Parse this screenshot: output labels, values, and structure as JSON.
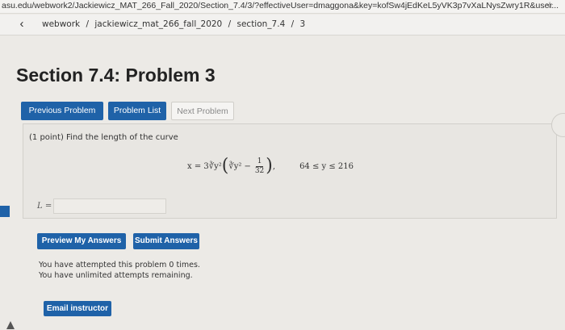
{
  "browser": {
    "url": "asu.edu/webwork2/Jackiewicz_MAT_266_Fall_2020/Section_7.4/3/?effectiveUser=dmaggona&key=kofSw4jEdKeL5yVK3p7vXaLNysZwry1R&user..."
  },
  "breadcrumb": {
    "items": [
      "webwork",
      "jackiewicz_mat_266_fall_2020",
      "section_7.4",
      "3"
    ],
    "separator": "/"
  },
  "page": {
    "title": "Section 7.4: Problem 3"
  },
  "nav": {
    "previous_label": "Previous Problem",
    "list_label": "Problem List",
    "next_label": "Next Problem"
  },
  "problem": {
    "points_text": "(1 point) Find the length of the curve",
    "formula_lhs": "x = 3",
    "formula_root": "∛",
    "formula_term": "y²",
    "formula_open": "(",
    "formula_inner_root": "∛",
    "formula_inner_term": "y²",
    "formula_minus": "−",
    "frac_num": "1",
    "frac_den": "32",
    "formula_close": ")",
    "formula_comma": ",",
    "range": "64 ≤ y ≤ 216",
    "answer_label": "L ="
  },
  "actions": {
    "preview_label": "Preview My Answers",
    "submit_label": "Submit Answers",
    "email_label": "Email instructor"
  },
  "status": {
    "attempted": "You have attempted this problem 0 times.",
    "remaining": "You have unlimited attempts remaining."
  },
  "colors": {
    "accent": "#1f62a8"
  }
}
